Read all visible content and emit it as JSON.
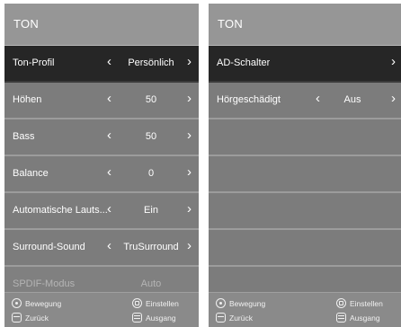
{
  "left": {
    "title": "TON",
    "items": [
      {
        "label": "Ton-Profil",
        "value": "Persönlich"
      },
      {
        "label": "Höhen",
        "value": "50"
      },
      {
        "label": "Bass",
        "value": "50"
      },
      {
        "label": "Balance",
        "value": "0"
      },
      {
        "label": "Automatische Lauts...",
        "value": "Ein"
      },
      {
        "label": "Surround-Sound",
        "value": "TruSurround"
      },
      {
        "label": "SPDIF-Modus",
        "value": "Auto"
      }
    ],
    "footer": {
      "move": "Bewegung",
      "enter": "Einstellen",
      "back": "Zurück",
      "exit": "Ausgang"
    }
  },
  "right": {
    "title": "TON",
    "items": [
      {
        "label": "AD-Schalter"
      },
      {
        "label": "Hörgeschädigt",
        "value": "Aus"
      }
    ],
    "footer": {
      "move": "Bewegung",
      "enter": "Einstellen",
      "back": "Zurück",
      "exit": "Ausgang"
    }
  },
  "icons": {
    "left_chevron": "‹",
    "right_chevron": "›",
    "move": "dpad-icon",
    "enter": "ok-button-icon",
    "back": "back-button-icon",
    "exit": "exit-button-icon"
  },
  "colors": {
    "panel_bg": "#7c7c7c",
    "selected_row": "#262626",
    "title_bar": "#969696",
    "text": "#ffffff"
  }
}
